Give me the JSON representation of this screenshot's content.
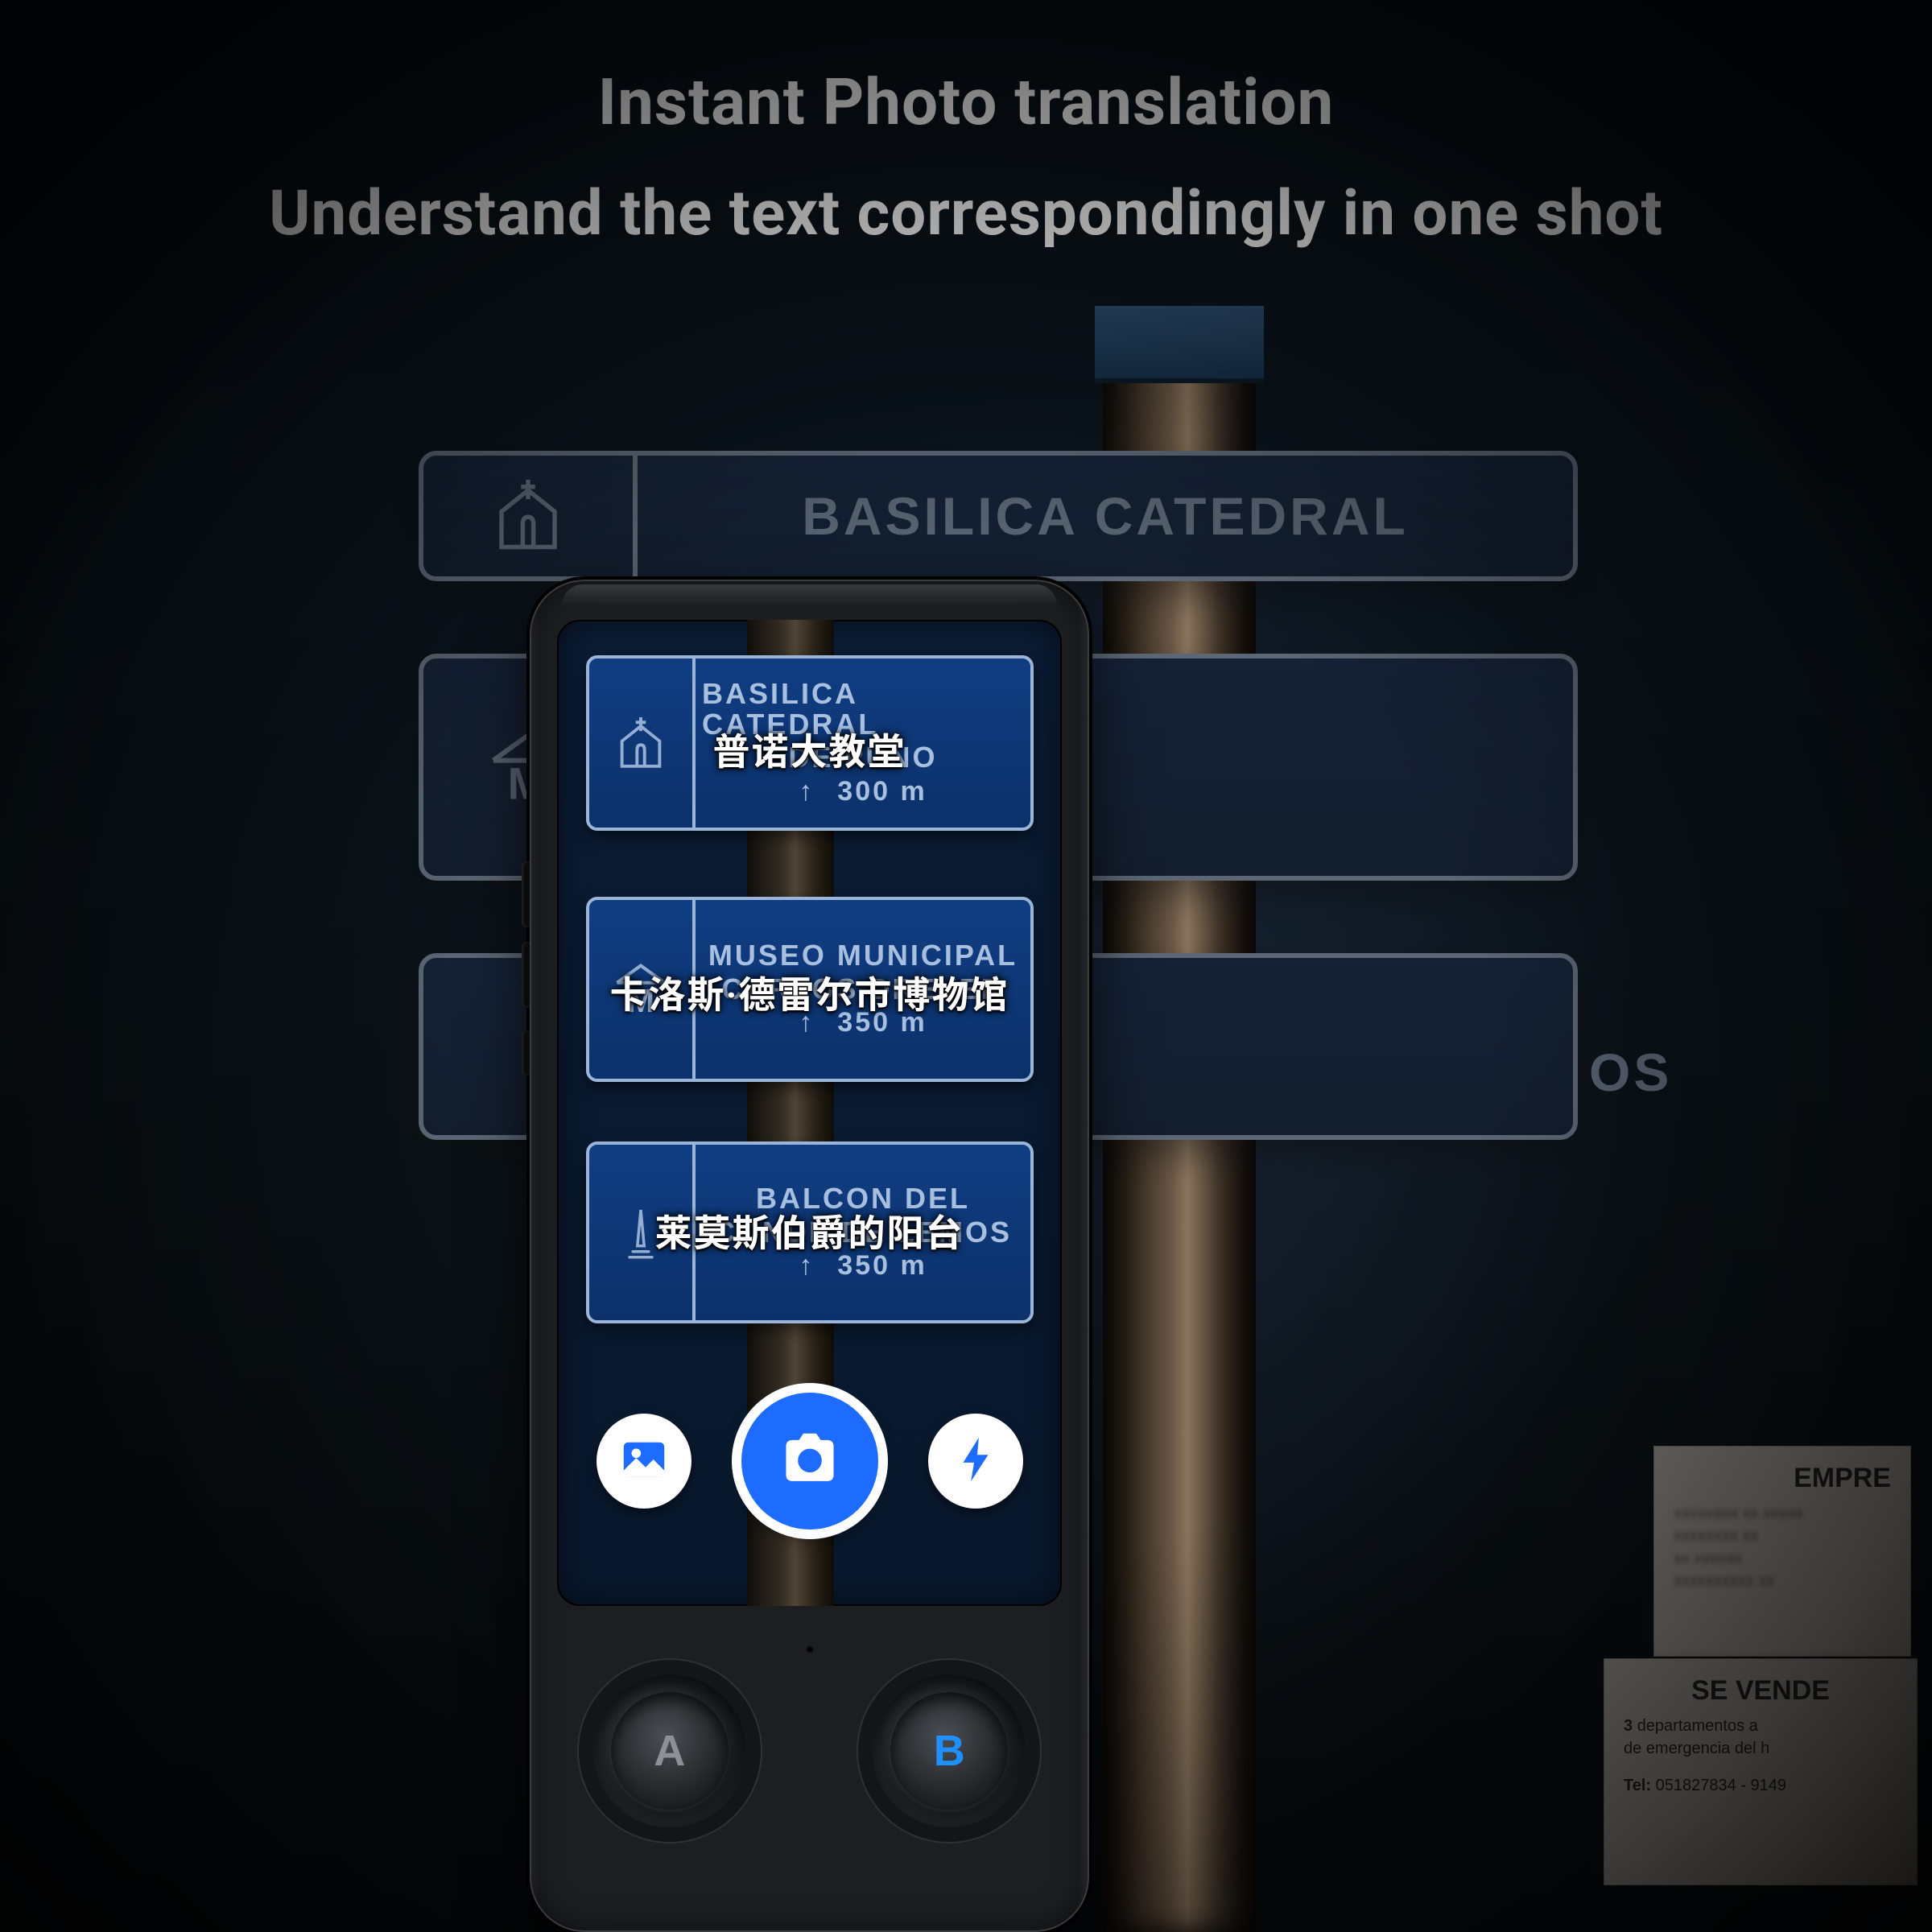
{
  "headline": {
    "line1": "Instant Photo translation",
    "line2": "Understand the text correspondingly in one shot"
  },
  "background_signs": {
    "top_visible_text": "BASILICA  CATEDRAL",
    "right_fragment": "OS"
  },
  "posters": {
    "p1": {
      "title_fragment": "EMPRE"
    },
    "p2": {
      "title": "SE VENDE",
      "line1_a": "3",
      "line1_b": "departamentos a",
      "line2": "de emergencia del h",
      "tel_label": "Tel:",
      "tel_value": "051827834 - 9149"
    }
  },
  "device": {
    "hw_button_a": "A",
    "hw_button_b": "B"
  },
  "screen": {
    "signs": [
      {
        "icon": "church",
        "line1": "BASILICA CATEDRAL",
        "line2": "DE PUNO",
        "distance": "300  m",
        "translation": "普诺大教堂"
      },
      {
        "icon": "museum",
        "icon_letter": "M",
        "line1": "MUSEO MUNICIPAL",
        "line2": "CARLOS DREYER",
        "distance": "350  m",
        "translation": "卡洛斯·德雷尔市博物馆"
      },
      {
        "icon": "monument",
        "line1": "BALCON DEL",
        "line2": "CONDE DE LEMOS",
        "distance": "350  m",
        "translation": "莱莫斯伯爵的阳台"
      }
    ],
    "ui": {
      "gallery_button": "gallery",
      "shutter_button": "camera",
      "flash_button": "flash"
    }
  }
}
